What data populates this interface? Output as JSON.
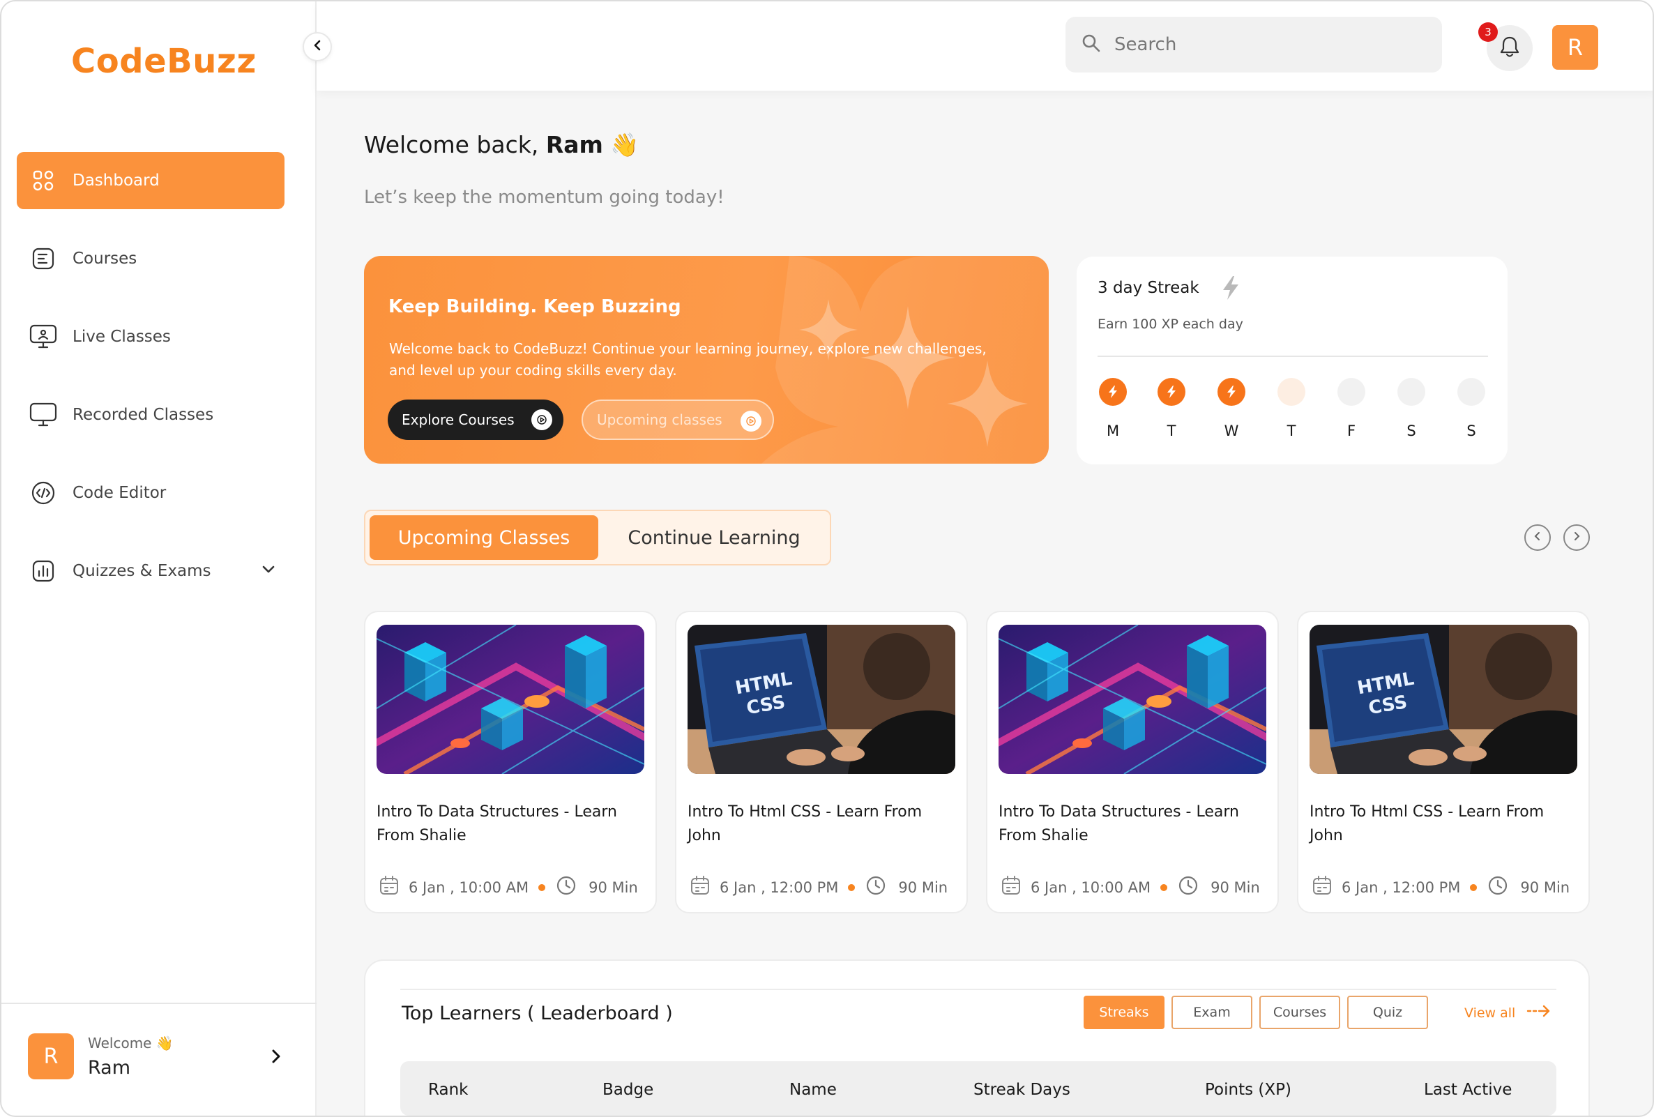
{
  "brand": {
    "name": "CodeBuzz",
    "accent": "#fb923c"
  },
  "sidebar": {
    "items": [
      {
        "label": "Dashboard",
        "icon": "grid-icon",
        "active": true
      },
      {
        "label": "Courses",
        "icon": "document-icon"
      },
      {
        "label": "Live Classes",
        "icon": "monitor-user-icon"
      },
      {
        "label": "Recorded Classes",
        "icon": "monitor-icon"
      },
      {
        "label": "Code Editor",
        "icon": "code-icon"
      },
      {
        "label": "Quizzes & Exams",
        "icon": "chart-icon",
        "expandable": true
      }
    ],
    "footer": {
      "avatar_initial": "R",
      "welcome": "Welcome 👋",
      "name": "Ram"
    }
  },
  "header": {
    "search_placeholder": "Search",
    "notifications_count": "3",
    "avatar_initial": "R"
  },
  "welcome": {
    "greeting": "Welcome back, ",
    "name": "Ram",
    "emoji": "👋",
    "subtitle": "Let’s keep the momentum going today!"
  },
  "hero": {
    "title": "Keep Building. Keep Buzzing",
    "text": "Welcome back to CodeBuzz! Continue your learning journey, explore new challenges, and level up your coding skills every day.",
    "primary_button": "Explore Courses",
    "secondary_button": "Upcoming classes"
  },
  "streak": {
    "title": "3 day Streak",
    "subtitle": "Earn 100 XP each day",
    "days": [
      {
        "label": "M",
        "state": "done"
      },
      {
        "label": "T",
        "state": "done"
      },
      {
        "label": "W",
        "state": "done"
      },
      {
        "label": "T",
        "state": "today"
      },
      {
        "label": "F",
        "state": "none"
      },
      {
        "label": "S",
        "state": "none"
      },
      {
        "label": "S",
        "state": "none"
      }
    ]
  },
  "tabs": {
    "upcoming": "Upcoming Classes",
    "continue": "Continue Learning"
  },
  "cards": [
    {
      "title": "Intro To Data Structures - Learn From Shalie",
      "date": "6 Jan , 10:00 AM",
      "duration": "90 Min",
      "image": "isometric-city"
    },
    {
      "title": "Intro To Html CSS - Learn From John",
      "date": "6 Jan , 12:00 PM",
      "duration": "90 Min",
      "image": "html-laptop"
    },
    {
      "title": "Intro To Data Structures - Learn From Shalie",
      "date": "6 Jan , 10:00 AM",
      "duration": "90 Min",
      "image": "isometric-city"
    },
    {
      "title": "Intro To Html CSS - Learn From John",
      "date": "6 Jan , 12:00 PM",
      "duration": "90 Min",
      "image": "html-laptop"
    }
  ],
  "leaderboard": {
    "title": "Top Learners ( Leaderboard )",
    "filters": [
      "Streaks",
      "Exam",
      "Courses",
      "Quiz"
    ],
    "view_all": "View all",
    "columns": [
      "Rank",
      "Badge",
      "Name",
      "Streak Days",
      "Points (XP)",
      "Last Active"
    ]
  },
  "thumb_text": {
    "line1": "HTML",
    "line2": "CSS"
  }
}
